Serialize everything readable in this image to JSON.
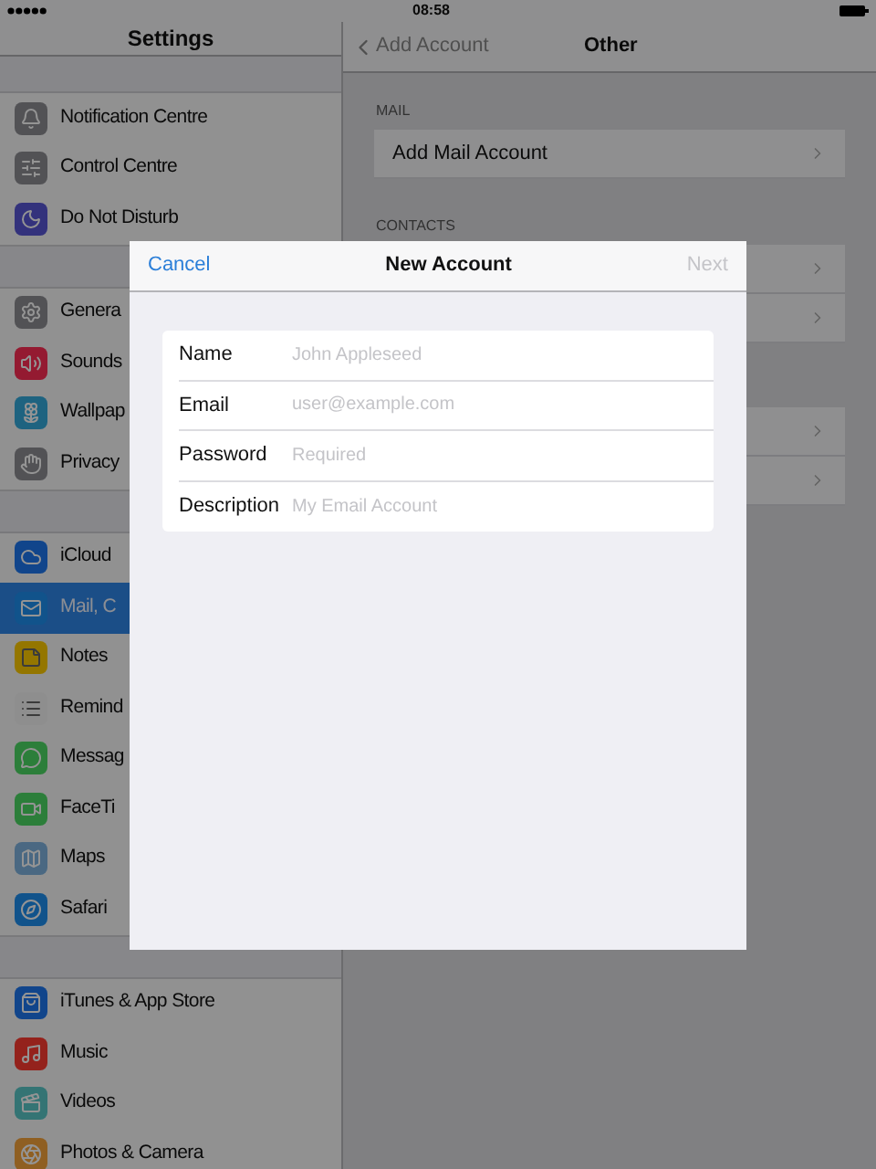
{
  "status_bar": {
    "time": "08:58"
  },
  "sidebar": {
    "title": "Settings",
    "groups": [
      [
        {
          "label": "Notification Centre",
          "selected": false
        },
        {
          "label": "Control Centre",
          "selected": false
        },
        {
          "label": "Do Not Disturb",
          "selected": false
        }
      ],
      [
        {
          "label": "Genera",
          "selected": false
        },
        {
          "label": "Sounds",
          "selected": false
        },
        {
          "label": "Wallpap",
          "selected": false
        },
        {
          "label": "Privacy",
          "selected": false
        }
      ],
      [
        {
          "label": "iCloud",
          "selected": false
        },
        {
          "label": "Mail, C",
          "selected": true
        },
        {
          "label": "Notes",
          "selected": false
        },
        {
          "label": "Remind",
          "selected": false
        },
        {
          "label": "Messag",
          "selected": false
        },
        {
          "label": "FaceTi",
          "selected": false
        },
        {
          "label": "Maps",
          "selected": false
        },
        {
          "label": "Safari",
          "selected": false
        }
      ],
      [
        {
          "label": "iTunes & App Store",
          "selected": false
        },
        {
          "label": "Music",
          "selected": false
        },
        {
          "label": "Videos",
          "selected": false
        },
        {
          "label": "Photos & Camera",
          "selected": false
        }
      ]
    ]
  },
  "detail": {
    "back_button": "Add Account",
    "title": "Other",
    "sections": [
      {
        "header": "MAIL",
        "rows": [
          "Add Mail Account"
        ]
      },
      {
        "header": "CONTACTS"
      }
    ]
  },
  "modal": {
    "cancel": "Cancel",
    "title": "New Account",
    "next": {
      "label": "Next",
      "disabled": true
    },
    "fields": [
      {
        "label": "Name",
        "placeholder": "John Appleseed"
      },
      {
        "label": "Email",
        "placeholder": "user@example.com"
      },
      {
        "label": "Password",
        "placeholder": "Required"
      },
      {
        "label": "Description",
        "placeholder": "My Email Account"
      }
    ]
  }
}
